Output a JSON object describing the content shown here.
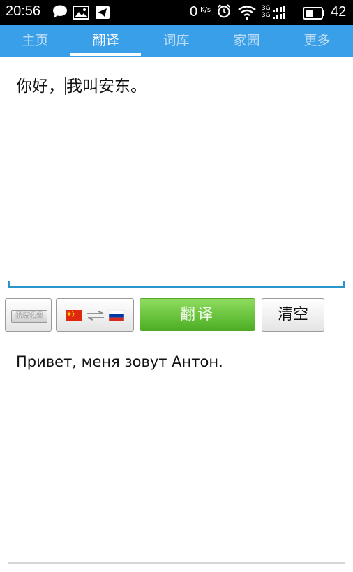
{
  "status_bar": {
    "time": "20:56",
    "net_speed": "0",
    "net_unit": "K/s",
    "net_labels": [
      "3G",
      "3G"
    ],
    "battery": "42"
  },
  "tabs": [
    {
      "label": "主页",
      "active": false
    },
    {
      "label": "翻译",
      "active": true
    },
    {
      "label": "词库",
      "active": false
    },
    {
      "label": "家园",
      "active": false
    },
    {
      "label": "更多",
      "active": false
    }
  ],
  "input": {
    "text_before_caret": "你好，",
    "text_after_caret": "我叫安东。"
  },
  "buttons": {
    "keyboard_label": "俄语键盘",
    "translate_label": "翻译",
    "clear_label": "清空"
  },
  "output": {
    "text": "Привет, меня зовут Антон."
  },
  "colors": {
    "tab_bar": "#3a9fe9",
    "input_underline": "#2a95c9",
    "translate_button": "#5cbf2f"
  }
}
